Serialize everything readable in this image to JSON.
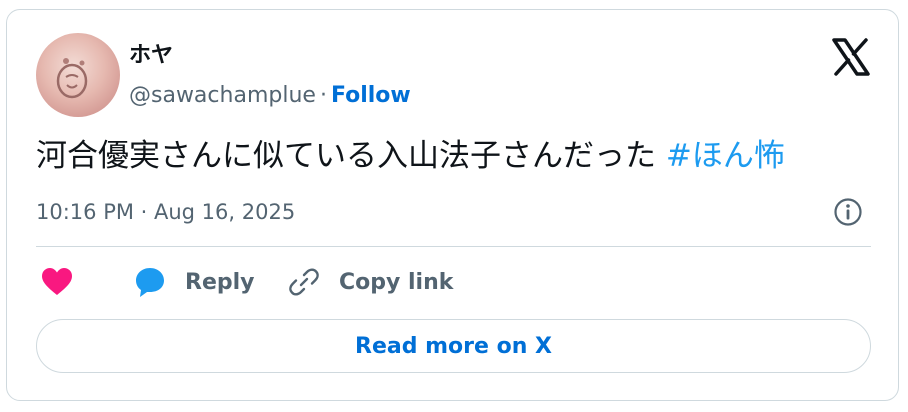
{
  "user": {
    "display_name": "ホヤ",
    "handle": "@sawachamplue",
    "separator": "·",
    "follow_label": "Follow"
  },
  "tweet": {
    "text": "河合優実さんに似ている入山法子さんだった",
    "hashtag": "#ほん怖",
    "timestamp": "10:16 PM · Aug 16, 2025"
  },
  "actions": {
    "reply_label": "Reply",
    "copy_label": "Copy link",
    "read_more_label": "Read more on X"
  },
  "colors": {
    "like": "#f91880",
    "reply_bubble": "#1d9bf0",
    "link": "#006fd6",
    "hashtag": "#1d9bf0",
    "secondary_text": "#536471"
  },
  "icons": [
    "x-logo-icon",
    "info-icon",
    "heart-icon",
    "reply-bubble-icon",
    "link-icon"
  ]
}
